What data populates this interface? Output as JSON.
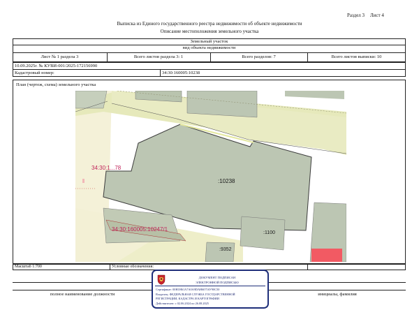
{
  "header": {
    "section": "Раздел 3",
    "sheet": "Лист 4",
    "title": "Выписка из Единого государственного реестра недвижимости об объекте недвижимости",
    "subtitle": "Описание местоположения земельного участка"
  },
  "object": {
    "type": "Земельный участок",
    "type_caption": "вид объекта недвижимости"
  },
  "info_row": {
    "sheet_no": "Лист № 1 раздела 3",
    "sheets_in_section": "Всего листов раздела 3: 1",
    "sections_total": "Всего разделов: 7",
    "sheets_total": "Всего листов выписки: 10"
  },
  "doc_number": "10.09.2025г. № КУВИ-001/2025-172156990",
  "cadastral": {
    "label": "Кадастровый номер:",
    "value": "34:30:160005:10238"
  },
  "plan_title": "План (чертеж, схема) земельного участка",
  "map_labels": {
    "left_parcel": "34:30:1...78",
    "main_parcel": ":10238",
    "diag_parcel": "34:30:160005:10247/1",
    "parcel_1100": ":1100",
    "parcel_9352": ":9352"
  },
  "footer": {
    "scale": "Масштаб 1:700",
    "legend": "Условные обозначения:",
    "position_caption": "полное наименование должности",
    "name_caption": "инициалы, фамилия"
  },
  "stamp": {
    "line1": "ДОКУМЕНТ ПОДПИСАН",
    "line2": "ЭЛЕКТРОННОЙ ПОДПИСЬЮ",
    "cert": "Сертификат: 00Н1Н61A7A0A9DАН60716У90С50",
    "owner1": "Владелец: ФЕДЕРАЛЬНАЯ СЛУЖБА ГОСУДАРСТВЕННОЙ",
    "owner2": "РЕГИСТРАЦИИ, КАДАСТРА И КАРТОГРАФИИ",
    "valid": "Действителен: с 02.06.2024 по 26.08.2025"
  },
  "colors": {
    "map_bg": "#f4f1d8",
    "road": "#e3e6b8",
    "parcel_fill": "#bcc6b3",
    "parcel_stroke": "#444",
    "label_red": "#c0245a",
    "red_square": "#f25a63",
    "stamp_blue": "#1f2f7a"
  }
}
